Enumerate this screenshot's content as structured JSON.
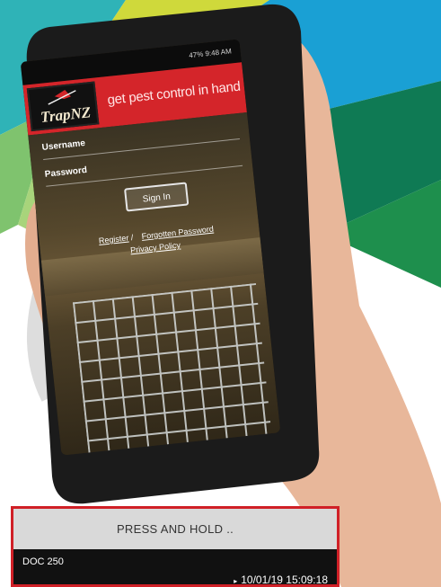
{
  "phone": {
    "status_bar": "47% 9:48 AM",
    "brand": "TrapNZ",
    "tagline": "get pest control in hand",
    "username_label": "Username",
    "password_label": "Password",
    "signin_label": "Sign In",
    "register_link": "Register",
    "separator": " / ",
    "forgot_link": "Forgotten Password",
    "privacy_link": "Privacy Policy"
  },
  "panel": {
    "header": "PRESS AND HOLD ..",
    "trap_name": "DOC 250",
    "timestamp": "10/01/19 15:09:18",
    "arrow": "▸"
  },
  "colors": {
    "header_red": "#d4252a",
    "panel_border": "#d02027"
  }
}
